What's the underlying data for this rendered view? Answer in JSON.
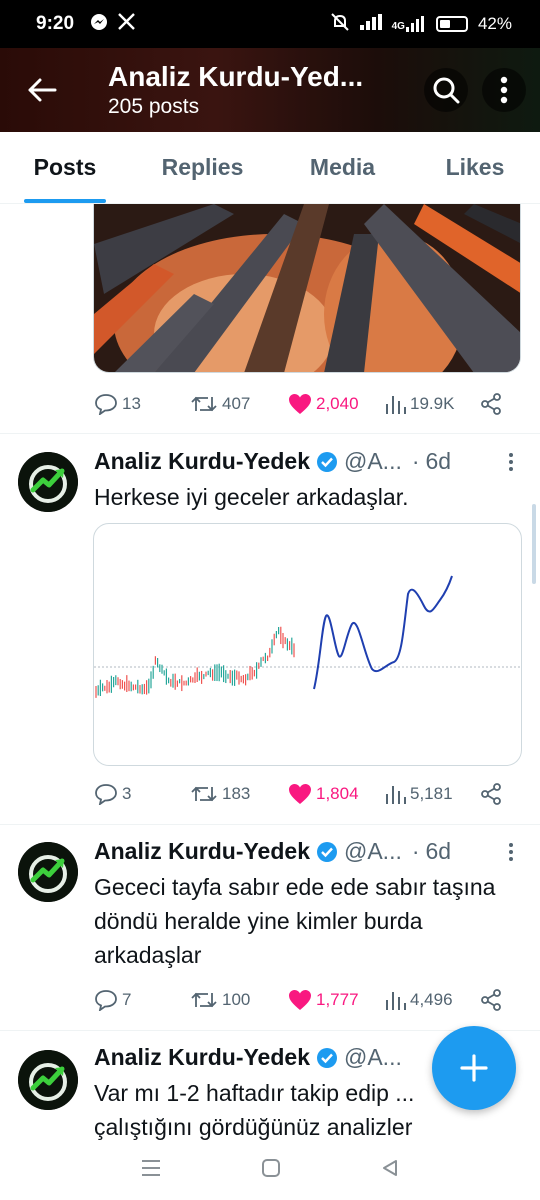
{
  "status_bar": {
    "time": "9:20",
    "network": "4G",
    "battery": "42%",
    "battery_level": 0.42,
    "icons": [
      "messenger-icon",
      "x-icon",
      "mute-icon",
      "signal-icon",
      "signal-4g-icon",
      "battery-icon"
    ]
  },
  "header": {
    "title": "Analiz Kurdu-Yed...",
    "subtitle": "205 posts"
  },
  "tabs": [
    {
      "label": "Posts",
      "active": true
    },
    {
      "label": "Replies",
      "active": false
    },
    {
      "label": "Media",
      "active": false
    },
    {
      "label": "Likes",
      "active": false
    }
  ],
  "posts": [
    {
      "stats": {
        "replies": "13",
        "reposts": "407",
        "likes": "2,040",
        "views": "19.9K"
      },
      "liked": true
    },
    {
      "author": "Analiz Kurdu-Yedek",
      "handle": "@A...",
      "separator": "·",
      "time": "6d",
      "text": "Herkese iyi geceler arkadaşlar.",
      "stats": {
        "replies": "3",
        "reposts": "183",
        "likes": "1,804",
        "views": "5,181"
      },
      "liked": true
    },
    {
      "author": "Analiz Kurdu-Yedek",
      "handle": "@A...",
      "separator": "·",
      "time": "6d",
      "text": "Gececi tayfa sabır ede ede sabır taşına döndü heralde yine kimler burda arkadaşlar",
      "stats": {
        "replies": "7",
        "reposts": "100",
        "likes": "1,777",
        "views": "4,496"
      },
      "liked": true
    },
    {
      "author": "Analiz Kurdu-Yedek",
      "handle": "@A...",
      "text": "Var mı 1-2 haftadır takip edip ... çalıştığını gördüğünüz analizler"
    }
  ],
  "colors": {
    "accent": "#1d9bf0",
    "like": "#f91880",
    "muted": "#536471",
    "text": "#0f1419"
  },
  "navbar": {
    "icons": [
      "recents-icon",
      "home-icon",
      "back-icon"
    ]
  }
}
